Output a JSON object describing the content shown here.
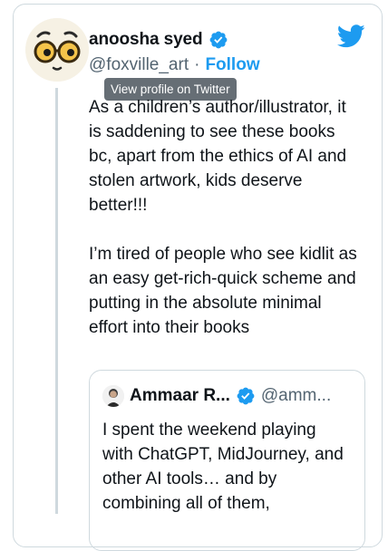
{
  "author": {
    "name": "anoosha syed",
    "handle": "@foxville_art",
    "separator": "·",
    "follow_label": "Follow",
    "avatar_icon": "round-glasses-face-icon",
    "verified_icon": "verified-badge-icon"
  },
  "tooltip": {
    "text": "View profile on Twitter"
  },
  "tweet": {
    "text": "As a children’s author/illustrator, it is saddening to see these books bc, apart from the ethics of AI and stolen artwork, kids deserve better!!!\n\nI’m tired of people who see kidlit as an easy get-rich-quick scheme and putting in the absolute minimal effort into their books"
  },
  "quoted_tweet": {
    "name": "Ammaar R...",
    "handle": "@amm...",
    "text": "I spent the weekend playing with ChatGPT, MidJourney, and other AI tools… and by combining all of them,"
  },
  "brand": {
    "logo_icon": "twitter-bird-icon",
    "accent_color": "#1d9bf0",
    "verified_color": "#1d9bf0"
  }
}
